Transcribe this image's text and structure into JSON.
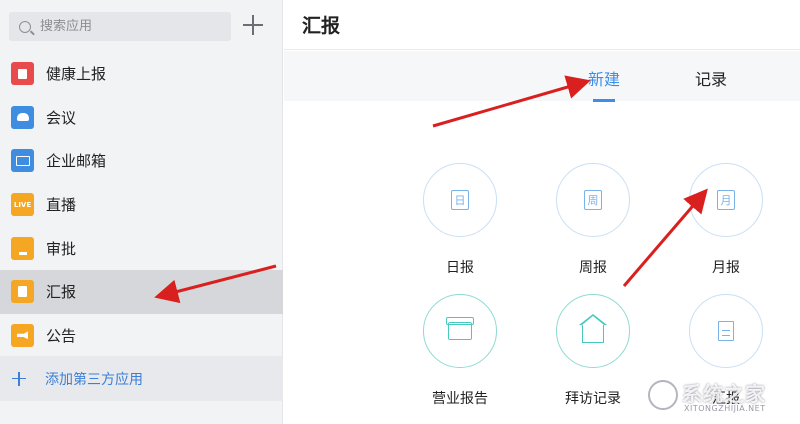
{
  "sidebar": {
    "search_placeholder": "搜索应用",
    "items": [
      {
        "label": "健康上报",
        "icon": "health-report-icon",
        "color": "#e84b4b"
      },
      {
        "label": "会议",
        "icon": "meeting-cloud-icon",
        "color": "#3e8de0"
      },
      {
        "label": "企业邮箱",
        "icon": "mail-icon",
        "color": "#3e8de0"
      },
      {
        "label": "直播",
        "icon": "live-icon",
        "icon_text": "LIVE",
        "color": "#f5a623"
      },
      {
        "label": "审批",
        "icon": "approval-stamp-icon",
        "color": "#f5a623"
      },
      {
        "label": "汇报",
        "icon": "report-icon",
        "color": "#f5a623",
        "active": true
      },
      {
        "label": "公告",
        "icon": "announcement-icon",
        "color": "#f5a623"
      }
    ],
    "add_third_party": "添加第三方应用"
  },
  "main": {
    "title": "汇报",
    "tabs": [
      {
        "label": "新建",
        "active": true
      },
      {
        "label": "记录",
        "active": false
      }
    ],
    "grid": [
      {
        "label": "日报",
        "icon_char": "日"
      },
      {
        "label": "周报",
        "icon_char": "周"
      },
      {
        "label": "月报",
        "icon_char": "月"
      },
      {
        "label": "营业报告",
        "icon": "store-icon"
      },
      {
        "label": "拜访记录",
        "icon": "house-icon"
      },
      {
        "label": "汇报",
        "icon": "document-icon"
      }
    ]
  },
  "watermark": {
    "text": "系统之家",
    "sub": "XITONGZHIJIA.NET"
  },
  "colors": {
    "accent": "#3d8ee6",
    "arrow": "#d9201f",
    "teal": "#48c9bd"
  }
}
